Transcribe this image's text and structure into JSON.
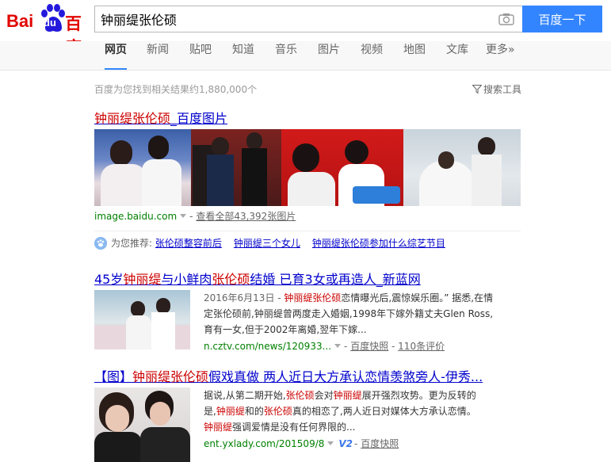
{
  "logo": {
    "latin_prefix": "Bai",
    "paw_text": "du",
    "chinese": "百度"
  },
  "search": {
    "query": "钟丽缇张伦硕",
    "button_label": "百度一下"
  },
  "tabs": [
    {
      "label": "网页",
      "active": true
    },
    {
      "label": "新闻"
    },
    {
      "label": "贴吧"
    },
    {
      "label": "知道"
    },
    {
      "label": "音乐"
    },
    {
      "label": "图片"
    },
    {
      "label": "视频"
    },
    {
      "label": "地图"
    },
    {
      "label": "文库"
    },
    {
      "label": "更多»"
    }
  ],
  "meta": {
    "result_count_text": "百度为您找到相关结果约1,880,000个",
    "tools_label": "搜索工具"
  },
  "image_result": {
    "title_em": "钟丽缇张伦硕",
    "title_rest": "_百度图片",
    "source": "image.baidu.com",
    "view_all": "查看全部43,392张图片"
  },
  "recommend": {
    "label": "为您推荐:",
    "items": [
      "张伦硕整容前后",
      "钟丽缇三个女儿",
      "钟丽缇张伦硕参加什么综艺节目"
    ]
  },
  "results": [
    {
      "title_parts": [
        {
          "text": "45岁",
          "em": false
        },
        {
          "text": "钟丽缇",
          "em": true
        },
        {
          "text": "与小鲜肉",
          "em": false
        },
        {
          "text": "张伦硕",
          "em": true
        },
        {
          "text": "结婚 已育3女或再造人_新蓝网",
          "em": false
        }
      ],
      "date": "2016年6月13日 - ",
      "lines": [
        [
          {
            "text": "钟丽缇张伦硕",
            "em": true
          },
          {
            "text": "恋情曝光后,震惊娱乐圈。” 据悉,在情",
            "em": false
          }
        ],
        [
          {
            "text": "定张伦硕前,钟丽缇曾两度走入婚姻,1998年下嫁外籍丈夫Glen Ross,",
            "em": false
          }
        ],
        [
          {
            "text": "育有一女,但于2002年离婚,翌年下嫁...",
            "em": false
          }
        ]
      ],
      "url": "n.cztv.com/news/120933...",
      "snapshot": "百度快照",
      "comments": "110条评价"
    },
    {
      "title_parts": [
        {
          "text": "【图】",
          "em": false
        },
        {
          "text": "钟丽缇张伦硕",
          "em": true
        },
        {
          "text": "假戏真做 两人近日大方承认恋情羡煞旁人-伊秀...",
          "em": false
        }
      ],
      "lines": [
        [
          {
            "text": "据说,从第二期开始,",
            "em": false
          },
          {
            "text": "张伦硕",
            "em": true
          },
          {
            "text": "会对",
            "em": false
          },
          {
            "text": "钟丽缇",
            "em": true
          },
          {
            "text": "展开强烈攻势。更为反转的",
            "em": false
          }
        ],
        [
          {
            "text": "是,",
            "em": false
          },
          {
            "text": "钟丽缇",
            "em": true
          },
          {
            "text": "和的",
            "em": false
          },
          {
            "text": "张伦硕",
            "em": true
          },
          {
            "text": "真的相恋了,两人近日对媒体大方承认恋情。",
            "em": false
          }
        ],
        [
          {
            "text": "钟丽缇",
            "em": true
          },
          {
            "text": "强调爱情是没有任何界限的...",
            "em": false
          }
        ]
      ],
      "url": "ent.yxlady.com/201509/8",
      "badge": "V2",
      "snapshot": "百度快照"
    }
  ],
  "colors": {
    "brand_red": "#e10601",
    "brand_blue": "#2319dc",
    "button_blue": "#3385ff",
    "link": "#0000cc",
    "highlight": "#cc0000",
    "url_green": "#008000"
  }
}
